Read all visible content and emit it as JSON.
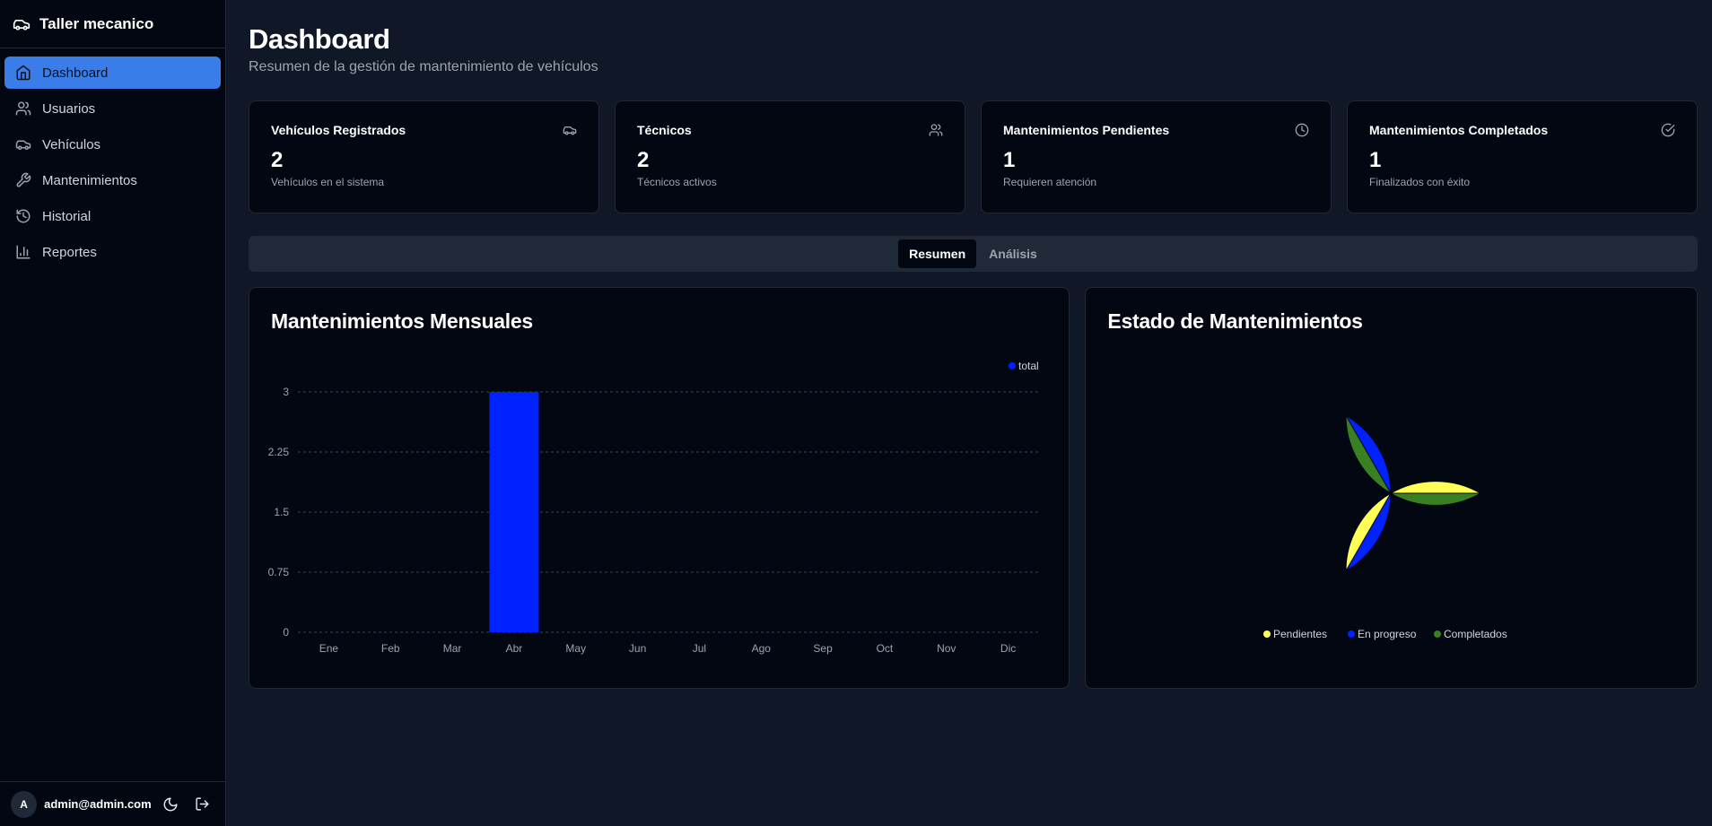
{
  "app": {
    "title": "Taller mecanico"
  },
  "sidebar": {
    "items": [
      {
        "label": "Dashboard",
        "icon": "home-icon",
        "active": true
      },
      {
        "label": "Usuarios",
        "icon": "users-icon",
        "active": false
      },
      {
        "label": "Vehículos",
        "icon": "car-icon",
        "active": false
      },
      {
        "label": "Mantenimientos",
        "icon": "wrench-icon",
        "active": false
      },
      {
        "label": "Historial",
        "icon": "history-icon",
        "active": false
      },
      {
        "label": "Reportes",
        "icon": "bar-chart-icon",
        "active": false
      }
    ],
    "user": {
      "initial": "A",
      "email": "admin@admin.com"
    }
  },
  "header": {
    "title": "Dashboard",
    "subtitle": "Resumen de la gestión de mantenimiento de vehículos"
  },
  "stats": [
    {
      "label": "Vehículos Registrados",
      "value": "2",
      "desc": "Vehículos en el sistema",
      "icon": "car-icon"
    },
    {
      "label": "Técnicos",
      "value": "2",
      "desc": "Técnicos activos",
      "icon": "users-icon"
    },
    {
      "label": "Mantenimientos Pendientes",
      "value": "1",
      "desc": "Requieren atención",
      "icon": "clock-icon"
    },
    {
      "label": "Mantenimientos Completados",
      "value": "1",
      "desc": "Finalizados con éxito",
      "icon": "check-circle-icon"
    }
  ],
  "tabs": [
    {
      "label": "Resumen",
      "active": true
    },
    {
      "label": "Análisis",
      "active": false
    }
  ],
  "colors": {
    "accent": "#3b7de8",
    "bar": "#0022ff",
    "pendientes": "#ffff55",
    "en_progreso": "#0022ff",
    "completados": "#388022"
  },
  "chart_data": [
    {
      "type": "bar",
      "title": "Mantenimientos Mensuales",
      "categories": [
        "Ene",
        "Feb",
        "Mar",
        "Abr",
        "May",
        "Jun",
        "Jul",
        "Ago",
        "Sep",
        "Oct",
        "Nov",
        "Dic"
      ],
      "series": [
        {
          "name": "total",
          "values": [
            0,
            0,
            0,
            3,
            0,
            0,
            0,
            0,
            0,
            0,
            0,
            0
          ]
        }
      ],
      "yticks": [
        "0",
        "0.75",
        "1.5",
        "2.25",
        "3"
      ],
      "ylim": [
        0,
        3
      ],
      "grid": true,
      "legend": "top-right"
    },
    {
      "type": "pie",
      "title": "Estado de Mantenimientos",
      "labels": [
        "Pendientes",
        "En progreso",
        "Completados"
      ],
      "values": [
        1,
        1,
        1
      ],
      "legend": "bottom"
    }
  ]
}
